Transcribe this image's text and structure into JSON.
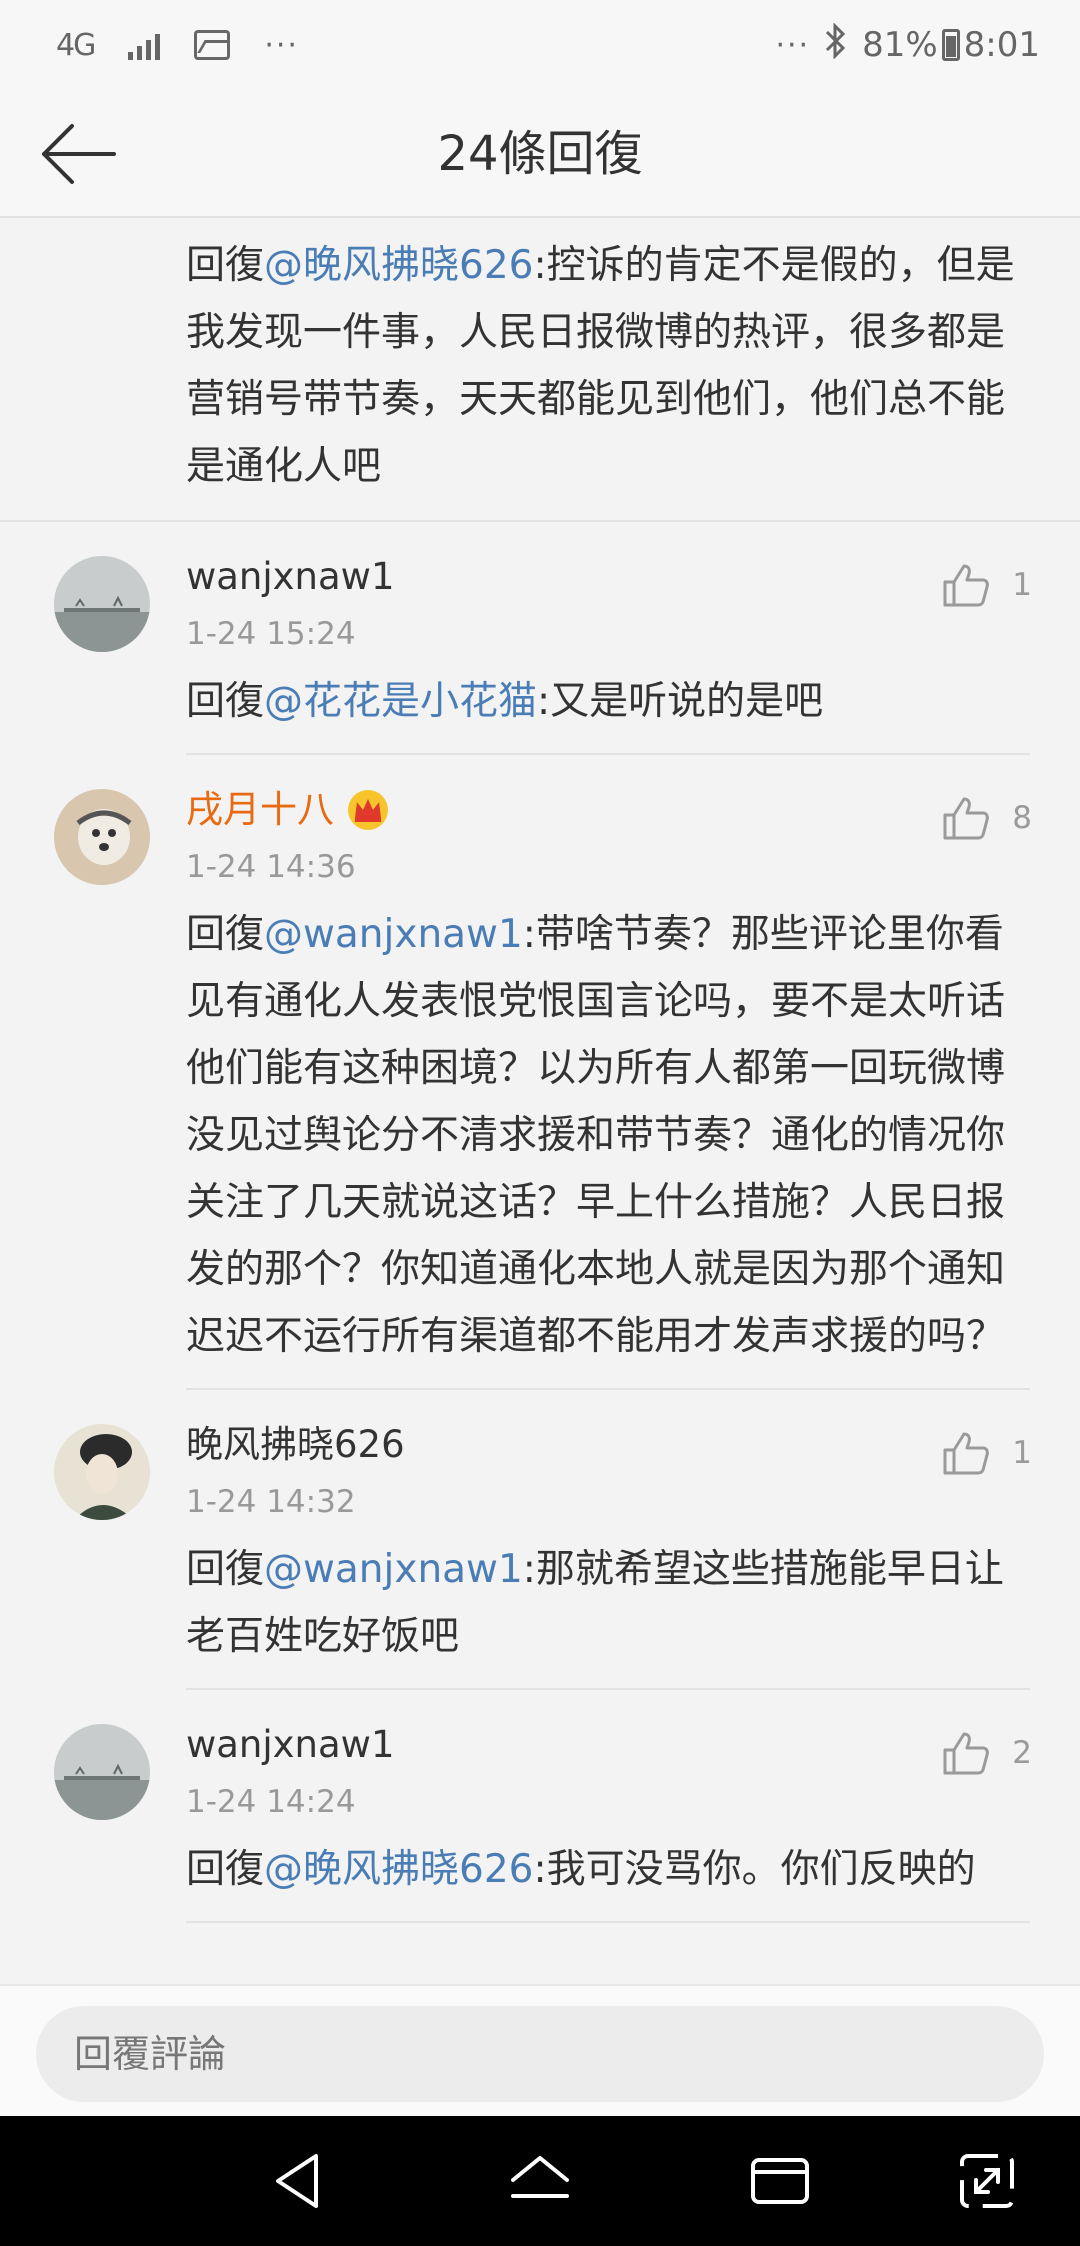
{
  "status_bar": {
    "network": "4G",
    "extra_dots_left": "···",
    "extra_dots_right": "···",
    "battery": "81%",
    "time": "8:01",
    "icons": [
      "signal-icon",
      "image-icon",
      "bluetooth-icon",
      "battery-icon"
    ]
  },
  "header": {
    "title": "24條回復",
    "back_icon": "back-arrow-icon"
  },
  "first_reply": {
    "prefix": "回復",
    "mention": "@晚风拂晓626",
    "text": ":控诉的肯定不是假的，但是我发现一件事，人民日报微博的热评，很多都是营销号带节奏，天天都能见到他们，他们总不能是通化人吧"
  },
  "comments": [
    {
      "user": "wanjxnaw1",
      "vip": false,
      "time": "1-24 15:24",
      "likes": "1",
      "prefix": "回復",
      "mention": "@花花是小花猫",
      "text": ":又是听说的是吧"
    },
    {
      "user": "戌月十八",
      "vip": true,
      "time": "1-24 14:36",
      "likes": "8",
      "prefix": "回復",
      "mention": "@wanjxnaw1",
      "text": ":带啥节奏？那些评论里你看见有通化人发表恨党恨国言论吗，要不是太听话他们能有这种困境？以为所有人都第一回玩微博没见过舆论分不清求援和带节奏？通化的情况你关注了几天就说这话？早上什么措施？人民日报发的那个？你知道通化本地人就是因为那个通知迟迟不运行所有渠道都不能用才发声求援的吗？"
    },
    {
      "user": "晚风拂晓626",
      "vip": false,
      "time": "1-24 14:32",
      "likes": "1",
      "prefix": "回復",
      "mention": "@wanjxnaw1",
      "text": ":那就希望这些措施能早日让老百姓吃好饭吧"
    },
    {
      "user": "wanjxnaw1",
      "vip": false,
      "time": "1-24 14:24",
      "likes": "2",
      "prefix": "回復",
      "mention": "@晚风拂晓626",
      "text": ":我可没骂你。你们反映的"
    }
  ],
  "reply_bar": {
    "placeholder": "回覆評論"
  },
  "colors": {
    "mention": "#4a7db5",
    "vip_name": "#e86a13",
    "meta": "#999999"
  }
}
